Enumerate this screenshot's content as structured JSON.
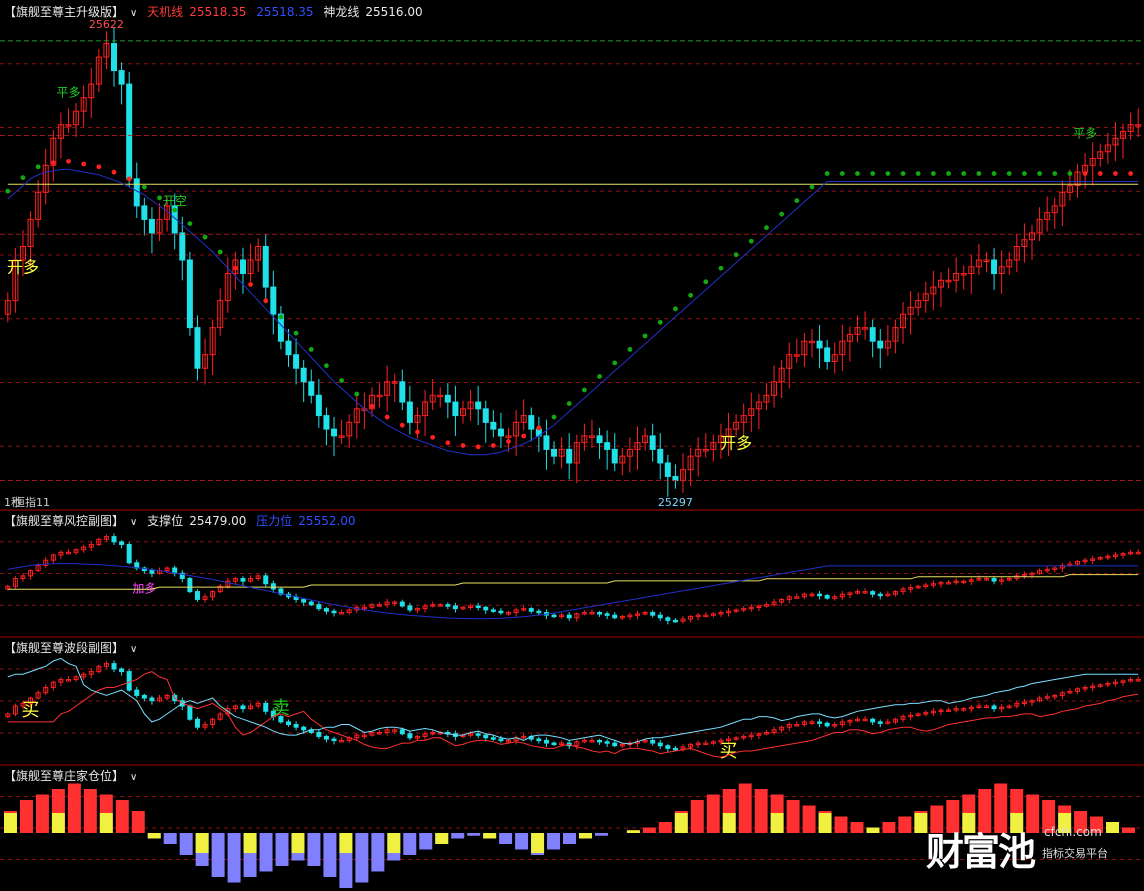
{
  "panels": {
    "main": {
      "name": "【旗舰至尊主升级版】",
      "indicators": [
        {
          "label": "天机线",
          "value": "25518.35",
          "color": "#ff3b3b"
        },
        {
          "label": "",
          "value": "25518.35",
          "color": "#3050ff"
        },
        {
          "label": "神龙线",
          "value": "25516.00",
          "color": "#e8e8e8"
        }
      ],
      "high_label": "25622",
      "low_label": "25297",
      "scale_label": "1秒",
      "sub_label": "恒指11"
    },
    "risk": {
      "name": "【旗舰至尊风控副图】",
      "indicators": [
        {
          "label": "支撑位",
          "value": "25479.00",
          "color": "#e8e8e8"
        },
        {
          "label": "压力位",
          "value": "25552.00",
          "color": "#3050ff"
        }
      ]
    },
    "wave": {
      "name": "【旗舰至尊波段副图】"
    },
    "position": {
      "name": "【旗舰至尊庄家仓位】"
    }
  },
  "signals": {
    "main": [
      {
        "text": "平多",
        "i": 8,
        "color": "#22cc22",
        "pos": "above"
      },
      {
        "text": "开多",
        "i": 2,
        "color": "#ffff40",
        "pos": "below"
      },
      {
        "text": "开空",
        "i": 22,
        "color": "#22cc22",
        "pos": "above"
      },
      {
        "text": "开多",
        "i": 96,
        "color": "#ffff40",
        "pos": "below"
      },
      {
        "text": "平多",
        "i": 142,
        "color": "#22cc22",
        "pos": "above"
      }
    ],
    "risk": [
      {
        "text": "加多",
        "i": 18,
        "color": "#ff44ff"
      }
    ],
    "wave": [
      {
        "text": "买",
        "i": 3,
        "color": "#ffff40"
      },
      {
        "text": "卖",
        "i": 36,
        "color": "#22cc22"
      },
      {
        "text": "买",
        "i": 95,
        "color": "#ffff40"
      }
    ]
  },
  "watermark": {
    "brand": "财富池",
    "site": "cfchi.com",
    "sub": "指标交易平台"
  },
  "colors": {
    "up": "#ff2020",
    "down": "#20e0e8",
    "dot_green": "#13a813",
    "dot_red": "#ff2020",
    "yellow_line": "#e8e060",
    "blue_line": "#2030c8",
    "grid": "#8a1010",
    "vol_red": "#ff3030",
    "vol_yellow": "#f0f040",
    "vol_blue": "#8080ff"
  },
  "chart_data": {
    "type": "candlestick",
    "y_range": [
      25290,
      25630
    ],
    "close": [
      25430,
      25460,
      25470,
      25490,
      25510,
      25530,
      25550,
      25560,
      25560,
      25570,
      25580,
      25590,
      25610,
      25620,
      25600,
      25590,
      25520,
      25500,
      25490,
      25480,
      25490,
      25500,
      25480,
      25460,
      25410,
      25380,
      25390,
      25410,
      25430,
      25450,
      25460,
      25450,
      25460,
      25470,
      25440,
      25420,
      25400,
      25390,
      25380,
      25370,
      25360,
      25345,
      25335,
      25330,
      25330,
      25340,
      25350,
      25350,
      25360,
      25360,
      25370,
      25370,
      25355,
      25340,
      25345,
      25355,
      25360,
      25360,
      25355,
      25345,
      25350,
      25355,
      25350,
      25340,
      25335,
      25330,
      25330,
      25340,
      25345,
      25335,
      25330,
      25320,
      25315,
      25320,
      25310,
      25325,
      25330,
      25330,
      25325,
      25320,
      25310,
      25315,
      25320,
      25325,
      25330,
      25320,
      25310,
      25300,
      25297,
      25305,
      25315,
      25320,
      25320,
      25325,
      25330,
      25335,
      25340,
      25345,
      25350,
      25355,
      25360,
      25370,
      25380,
      25390,
      25390,
      25400,
      25400,
      25395,
      25385,
      25390,
      25400,
      25405,
      25410,
      25410,
      25400,
      25395,
      25400,
      25410,
      25420,
      25425,
      25430,
      25435,
      25440,
      25445,
      25445,
      25450,
      25450,
      25455,
      25460,
      25460,
      25450,
      25455,
      25460,
      25470,
      25475,
      25480,
      25490,
      25495,
      25500,
      25510,
      25515,
      25525,
      25530,
      25535,
      25540,
      25545,
      25550,
      25555,
      25560,
      25560
    ],
    "tianji_line": [
      25505,
      25510,
      25515,
      25520,
      25523,
      25525,
      25526,
      25527,
      25527,
      25526,
      25525,
      25524,
      25523,
      25521,
      25519,
      25517,
      25514,
      25511,
      25508,
      25504,
      25500,
      25496,
      25491,
      25486,
      25481,
      25476,
      25471,
      25466,
      25460,
      25454,
      25448,
      25442,
      25436,
      25430,
      25424,
      25418,
      25412,
      25406,
      25400,
      25394,
      25388,
      25382,
      25376,
      25370,
      25365,
      25360,
      25355,
      25350,
      25346,
      25342,
      25338,
      25335,
      25332,
      25329,
      25327,
      25325,
      25323,
      25321,
      25319,
      25318,
      25317,
      25316,
      25316,
      25316,
      25317,
      25318,
      25320,
      25322,
      25324,
      25327,
      25330,
      25334,
      25338,
      25343,
      25348,
      25353,
      25358,
      25363,
      25368,
      25373,
      25378,
      25383,
      25388,
      25393,
      25398,
      25403,
      25408,
      25413,
      25418,
      25423,
      25428,
      25433,
      25438,
      25443,
      25448,
      25453,
      25458,
      25463,
      25468,
      25473,
      25478,
      25483,
      25488,
      25493,
      25498,
      25503,
      25508,
      25513,
      25518,
      25518,
      25518,
      25518,
      25518,
      25518,
      25518,
      25518,
      25518,
      25518,
      25518,
      25518,
      25518,
      25518,
      25518,
      25518,
      25518,
      25518,
      25518,
      25518,
      25518,
      25518,
      25518,
      25518,
      25518,
      25518,
      25518,
      25518,
      25518,
      25518,
      25518,
      25518,
      25518,
      25518,
      25518,
      25518,
      25518,
      25518,
      25518,
      25518,
      25518,
      25518
    ],
    "shenlong_line": [
      25516,
      25516,
      25516,
      25516,
      25516,
      25516,
      25516,
      25516,
      25516,
      25516,
      25516,
      25516,
      25516,
      25516,
      25516,
      25516,
      25516,
      25516,
      25516,
      25516,
      25516,
      25516,
      25516,
      25516,
      25516,
      25516,
      25516,
      25516,
      25516,
      25516,
      25516,
      25516,
      25516,
      25516,
      25516,
      25516,
      25516,
      25516,
      25516,
      25516,
      25516,
      25516,
      25516,
      25516,
      25516,
      25516,
      25516,
      25516,
      25516,
      25516,
      25516,
      25516,
      25516,
      25516,
      25516,
      25516,
      25516,
      25516,
      25516,
      25516,
      25516,
      25516,
      25516,
      25516,
      25516,
      25516,
      25516,
      25516,
      25516,
      25516,
      25516,
      25516,
      25516,
      25516,
      25516,
      25516,
      25516,
      25516,
      25516,
      25516,
      25516,
      25516,
      25516,
      25516,
      25516,
      25516,
      25516,
      25516,
      25516,
      25516,
      25516,
      25516,
      25516,
      25516,
      25516,
      25516,
      25516,
      25516,
      25516,
      25516,
      25516,
      25516,
      25516,
      25516,
      25516,
      25516,
      25516,
      25516,
      25516,
      25516,
      25516,
      25516,
      25516,
      25516,
      25516,
      25516,
      25516,
      25516,
      25516,
      25516,
      25516,
      25516,
      25516,
      25516,
      25516,
      25516,
      25516,
      25516,
      25516,
      25516,
      25516,
      25516,
      25516,
      25516,
      25516,
      25516,
      25516,
      25516,
      25516,
      25516,
      25516,
      25516,
      25516,
      25516,
      25516,
      25516,
      25516,
      25516,
      25516,
      25516
    ],
    "reference_lines": [
      25622,
      25479,
      25552,
      25297
    ],
    "position_bars": [
      40,
      60,
      70,
      80,
      90,
      80,
      70,
      60,
      40,
      -10,
      -20,
      -40,
      -60,
      -80,
      -90,
      -80,
      -70,
      -60,
      -50,
      -60,
      -80,
      -100,
      -90,
      -70,
      -50,
      -40,
      -30,
      -20,
      -10,
      -5,
      -10,
      -20,
      -30,
      -40,
      -30,
      -20,
      -10,
      -5,
      0,
      5,
      10,
      20,
      40,
      60,
      70,
      80,
      90,
      80,
      70,
      60,
      50,
      40,
      30,
      20,
      10,
      20,
      30,
      40,
      50,
      60,
      70,
      80,
      90,
      80,
      70,
      60,
      50,
      40,
      30,
      20,
      10
    ]
  }
}
